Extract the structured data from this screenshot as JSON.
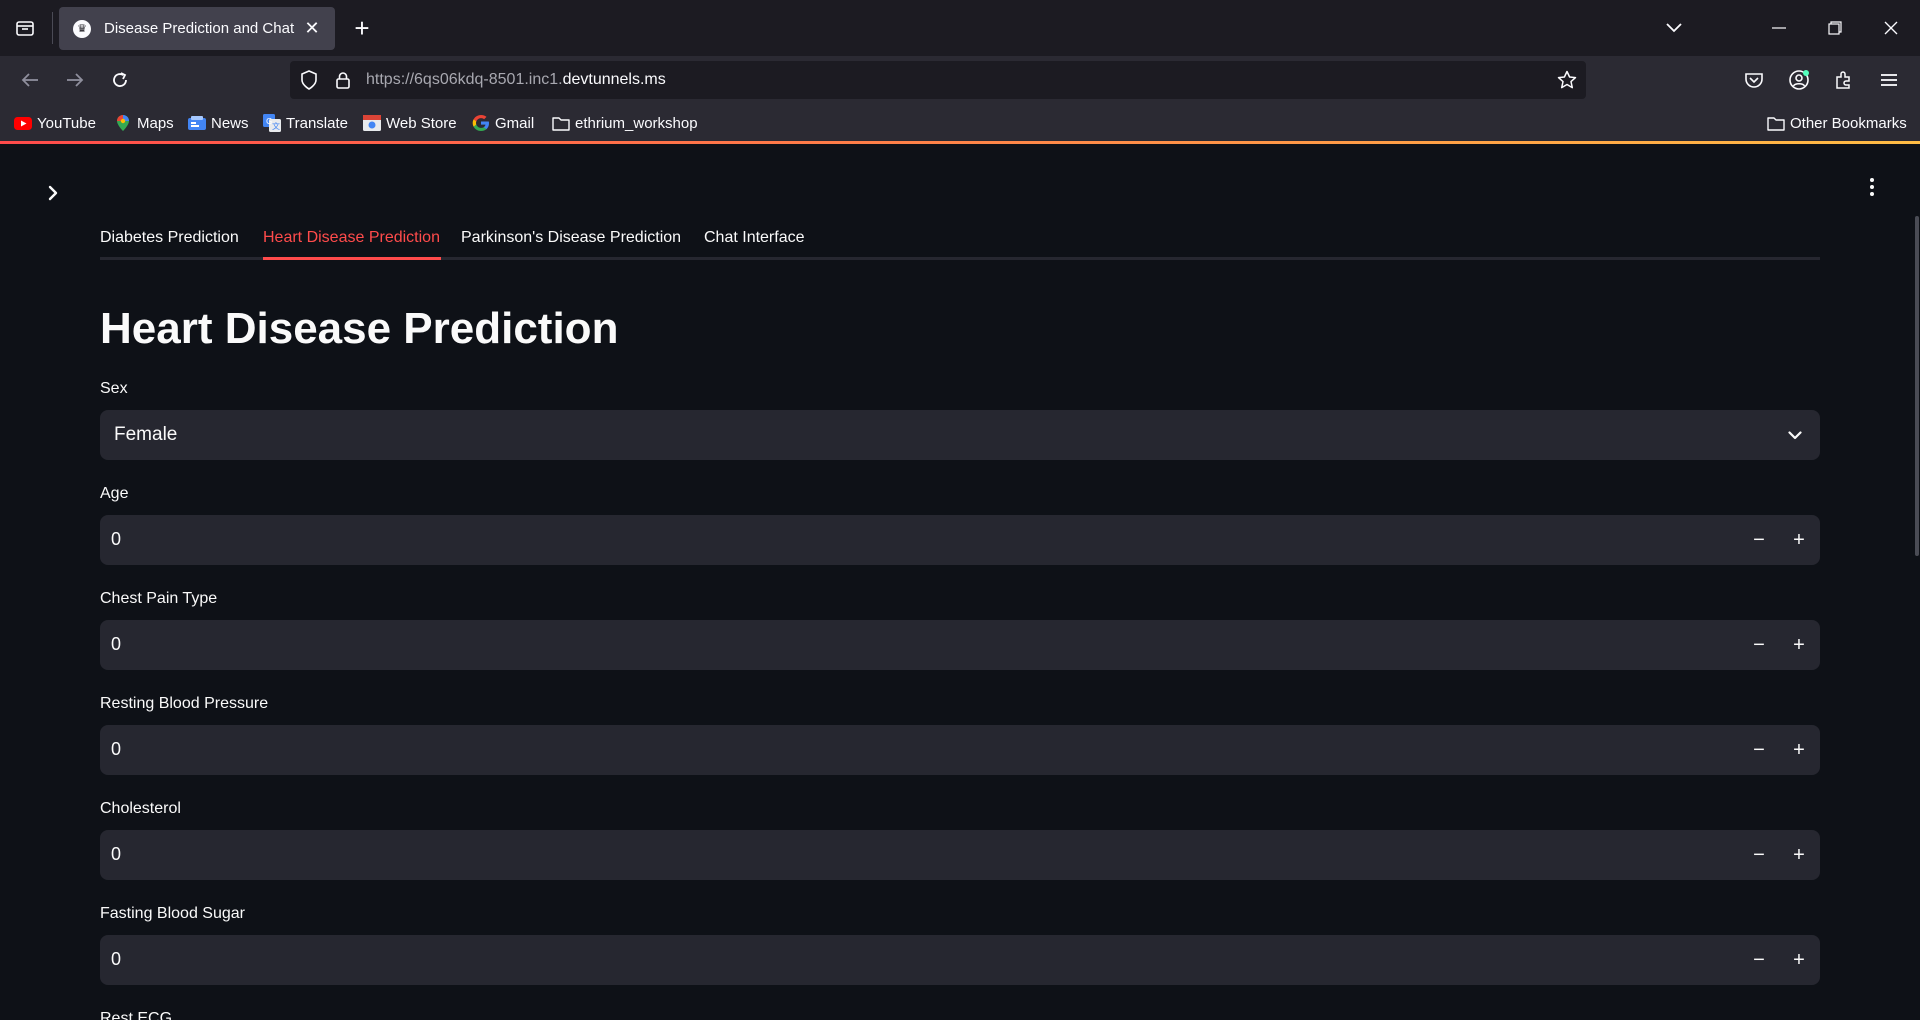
{
  "browser": {
    "tab_title": "Disease Prediction and Chat",
    "url_prefix": "https://6qs06kdq-8501.inc1.",
    "url_domain": "devtunnels.ms",
    "bookmarks": [
      {
        "label": "YouTube",
        "icon": "youtube-icon"
      },
      {
        "label": "Maps",
        "icon": "maps-icon"
      },
      {
        "label": "News",
        "icon": "news-icon"
      },
      {
        "label": "Translate",
        "icon": "translate-icon"
      },
      {
        "label": "Web Store",
        "icon": "webstore-icon"
      },
      {
        "label": "Gmail",
        "icon": "google-icon"
      },
      {
        "label": "ethrium_workshop",
        "icon": "folder-icon"
      }
    ],
    "other_bookmarks": "Other Bookmarks"
  },
  "app": {
    "tabs": [
      {
        "label": "Diabetes Prediction",
        "active": false
      },
      {
        "label": "Heart Disease Prediction",
        "active": true
      },
      {
        "label": "Parkinson's Disease Prediction",
        "active": false
      },
      {
        "label": "Chat Interface",
        "active": false
      }
    ],
    "title": "Heart Disease Prediction",
    "sex": {
      "label": "Sex",
      "value": "Female"
    },
    "fields": [
      {
        "label": "Age",
        "value": "0"
      },
      {
        "label": "Chest Pain Type",
        "value": "0"
      },
      {
        "label": "Resting Blood Pressure",
        "value": "0"
      },
      {
        "label": "Cholesterol",
        "value": "0"
      },
      {
        "label": "Fasting Blood Sugar",
        "value": "0"
      }
    ],
    "partial_label": "Rest ECG"
  },
  "colors": {
    "accent": "#ff4b4b",
    "background": "#0e1117",
    "input_bg": "#262730"
  }
}
